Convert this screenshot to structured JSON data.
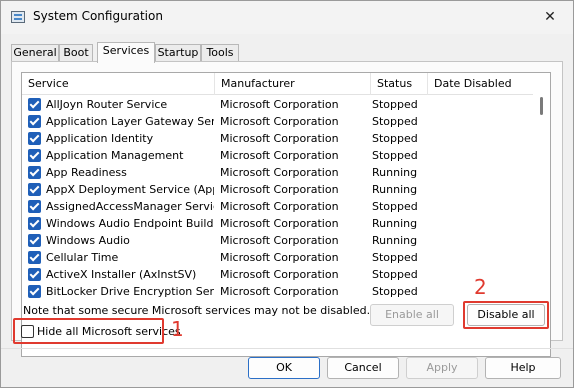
{
  "window": {
    "title": "System Configuration"
  },
  "tabs": [
    {
      "label": "General",
      "active": false
    },
    {
      "label": "Boot",
      "active": false
    },
    {
      "label": "Services",
      "active": true
    },
    {
      "label": "Startup",
      "active": false
    },
    {
      "label": "Tools",
      "active": false
    }
  ],
  "table": {
    "columns": [
      "Service",
      "Manufacturer",
      "Status",
      "Date Disabled"
    ],
    "rows": [
      {
        "service": "AllJoyn Router Service",
        "manufacturer": "Microsoft Corporation",
        "status": "Stopped",
        "date": "",
        "checked": true
      },
      {
        "service": "Application Layer Gateway Service",
        "manufacturer": "Microsoft Corporation",
        "status": "Stopped",
        "date": "",
        "checked": true
      },
      {
        "service": "Application Identity",
        "manufacturer": "Microsoft Corporation",
        "status": "Stopped",
        "date": "",
        "checked": true
      },
      {
        "service": "Application Management",
        "manufacturer": "Microsoft Corporation",
        "status": "Stopped",
        "date": "",
        "checked": true
      },
      {
        "service": "App Readiness",
        "manufacturer": "Microsoft Corporation",
        "status": "Running",
        "date": "",
        "checked": true
      },
      {
        "service": "AppX Deployment Service (AppX...",
        "manufacturer": "Microsoft Corporation",
        "status": "Running",
        "date": "",
        "checked": true
      },
      {
        "service": "AssignedAccessManager Service",
        "manufacturer": "Microsoft Corporation",
        "status": "Stopped",
        "date": "",
        "checked": true
      },
      {
        "service": "Windows Audio Endpoint Builder",
        "manufacturer": "Microsoft Corporation",
        "status": "Running",
        "date": "",
        "checked": true
      },
      {
        "service": "Windows Audio",
        "manufacturer": "Microsoft Corporation",
        "status": "Running",
        "date": "",
        "checked": true
      },
      {
        "service": "Cellular Time",
        "manufacturer": "Microsoft Corporation",
        "status": "Stopped",
        "date": "",
        "checked": true
      },
      {
        "service": "ActiveX Installer (AxInstSV)",
        "manufacturer": "Microsoft Corporation",
        "status": "Stopped",
        "date": "",
        "checked": true
      },
      {
        "service": "BitLocker Drive Encryption Service",
        "manufacturer": "Microsoft Corporation",
        "status": "Stopped",
        "date": "",
        "checked": true
      }
    ]
  },
  "note": "Note that some secure Microsoft services may not be disabled.",
  "buttons": {
    "enable_all": "Enable all",
    "disable_all": "Disable all",
    "ok": "OK",
    "cancel": "Cancel",
    "apply": "Apply",
    "help": "Help"
  },
  "hide_ms": {
    "label": "Hide all Microsoft services",
    "checked": false
  },
  "annotations": {
    "one": "1",
    "two": "2"
  },
  "colors": {
    "annotation": "#e03a2f",
    "check_fill": "#1f5fb8"
  }
}
